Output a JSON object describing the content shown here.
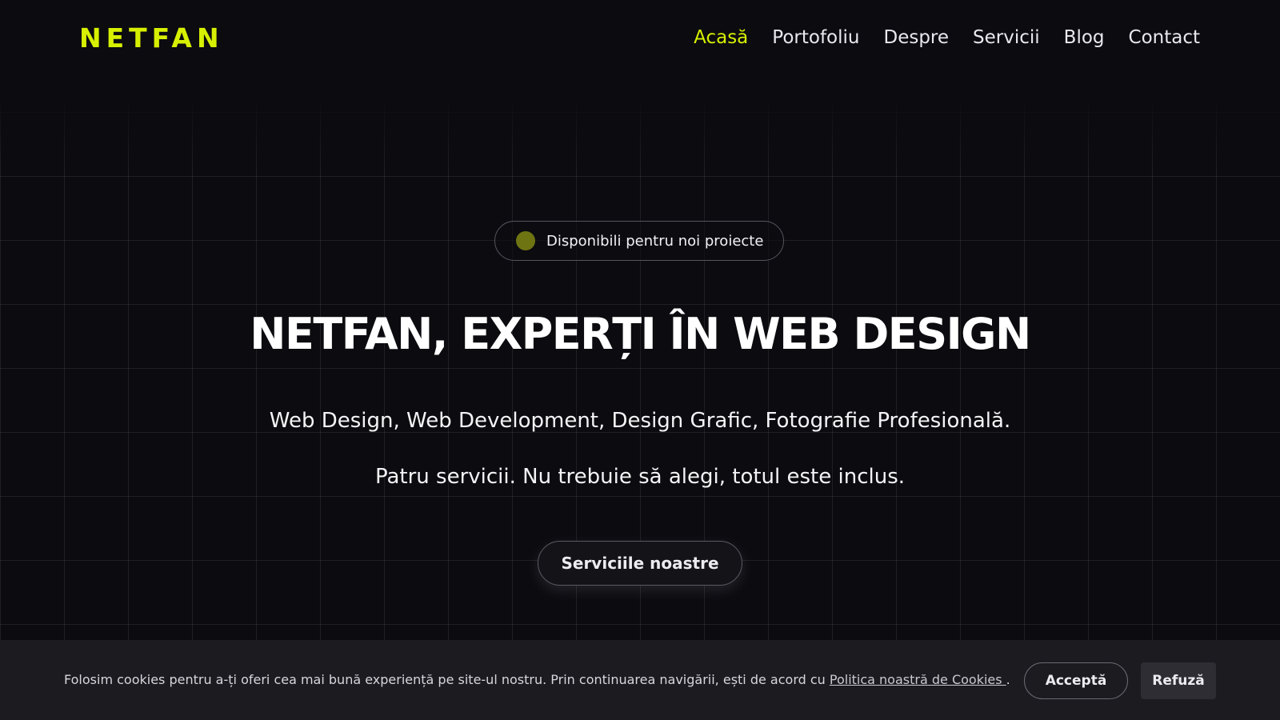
{
  "brand": {
    "logo_text": "NETFAN",
    "accent_color": "#d7f000"
  },
  "nav": {
    "items": [
      {
        "label": "Acasă",
        "active": true
      },
      {
        "label": "Portofoliu",
        "active": false
      },
      {
        "label": "Despre",
        "active": false
      },
      {
        "label": "Servicii",
        "active": false
      },
      {
        "label": "Blog",
        "active": false
      },
      {
        "label": "Contact",
        "active": false
      }
    ]
  },
  "hero": {
    "badge_text": "Disponibili pentru noi proiecte",
    "badge_dot_color": "#6f7412",
    "title": "NETFAN, EXPERȚI ÎN WEB DESIGN",
    "subtitle": "Web Design, Web Development, Design Grafic, Fotografie Profesională.",
    "tagline": "Patru servicii. Nu trebuie să alegi, totul este inclus.",
    "cta_label": "Serviciile noastre"
  },
  "cookie_banner": {
    "text": "Folosim cookies pentru a-ți oferi cea mai bună experiență pe site-ul nostru. Prin continuarea navigării, ești de acord cu ",
    "link_text": "Politica noastră de Cookies ",
    "text_end": ".",
    "accept_label": "Acceptă",
    "refuse_label": "Refuză"
  }
}
